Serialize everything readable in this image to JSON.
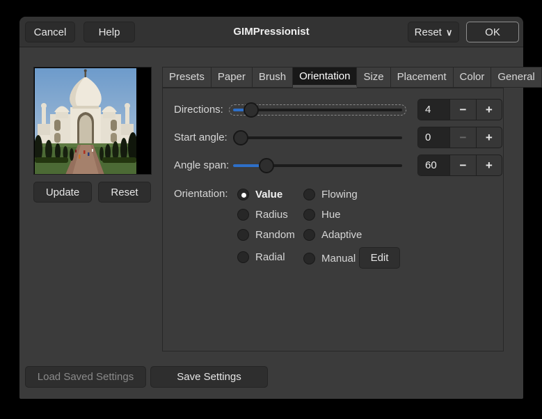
{
  "window_title": "GIMPressionist",
  "header": {
    "cancel_label": "Cancel",
    "help_label": "Help",
    "reset_label": "Reset",
    "reset_chevron": "∨",
    "ok_label": "OK"
  },
  "preview": {
    "image_alt": "taj-mahal-preview",
    "update_label": "Update",
    "reset_label": "Reset"
  },
  "tabs": {
    "items": [
      "Presets",
      "Paper",
      "Brush",
      "Orientation",
      "Size",
      "Placement",
      "Color",
      "General"
    ],
    "active": "Orientation"
  },
  "orientation": {
    "sliders": [
      {
        "label": "Directions:",
        "value": "4",
        "focused": true,
        "minus_disabled": false
      },
      {
        "label": "Start angle:",
        "value": "0",
        "focused": false,
        "minus_disabled": true
      },
      {
        "label": "Angle span:",
        "value": "60",
        "focused": false,
        "minus_disabled": false
      }
    ],
    "spinner_minus": "−",
    "spinner_plus": "+",
    "group_label": "Orientation:",
    "radios": [
      {
        "label": "Value",
        "selected": true
      },
      {
        "label": "Radius",
        "selected": false
      },
      {
        "label": "Random",
        "selected": false
      },
      {
        "label": "Radial",
        "selected": false
      },
      {
        "label": "Flowing",
        "selected": false
      },
      {
        "label": "Hue",
        "selected": false
      },
      {
        "label": "Adaptive",
        "selected": false
      },
      {
        "label": "Manual",
        "selected": false
      }
    ],
    "edit_label": "Edit"
  },
  "footer": {
    "load_label": "Load Saved Settings",
    "load_disabled": true,
    "save_label": "Save Settings"
  },
  "colors": {
    "accent_blue": "#2e6fc8",
    "window_bg": "#3b3b3b",
    "header_bg": "#333333",
    "active_tab_bg": "#181818",
    "entry_bg": "#242424",
    "outer_bg": "#000000"
  }
}
